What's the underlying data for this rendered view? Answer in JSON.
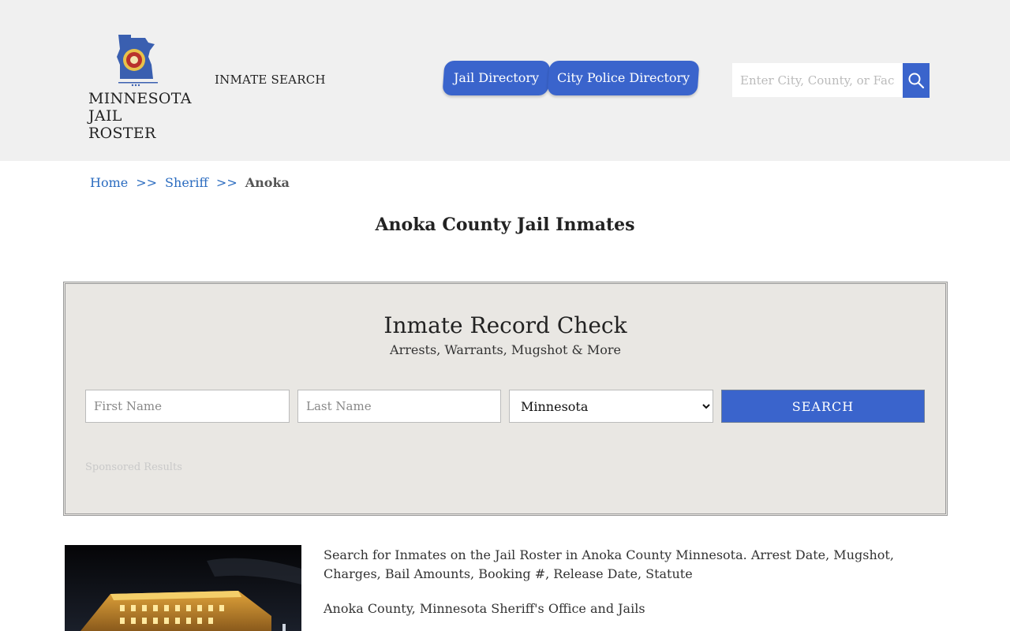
{
  "header": {
    "logo_line1": "MINNESOTA",
    "logo_line2": "JAIL ROSTER",
    "nav_inmate_search": "INMATE SEARCH",
    "tabs": [
      {
        "label": "Jail Directory"
      },
      {
        "label": "City Police Directory"
      }
    ],
    "search": {
      "placeholder": "Enter City, County, or Facility",
      "button_icon": "search-icon"
    }
  },
  "breadcrumb": {
    "items": [
      "Home",
      "Sheriff"
    ],
    "separator": ">>",
    "current": "Anoka"
  },
  "page_title": "Anoka County Jail Inmates",
  "record_check": {
    "title": "Inmate Record Check",
    "subtitle": "Arrests, Warrants, Mugshot & More",
    "first_name_placeholder": "First Name",
    "last_name_placeholder": "Last Name",
    "state_selected": "Minnesota",
    "search_label": "SEARCH",
    "sponsored": "Sponsored Results"
  },
  "content": {
    "paragraph1": "Search for Inmates on the Jail Roster in Anoka County Minnesota. Arrest Date, Mugshot, Charges, Bail Amounts, Booking #, Release Date, Statute",
    "paragraph2": "Anoka County, Minnesota Sheriff's Office and Jails"
  },
  "colors": {
    "accent": "#3a64cc",
    "header_bg": "#f0f0f0",
    "panel_bg": "#e9e7e3",
    "link": "#2b6cc0"
  }
}
